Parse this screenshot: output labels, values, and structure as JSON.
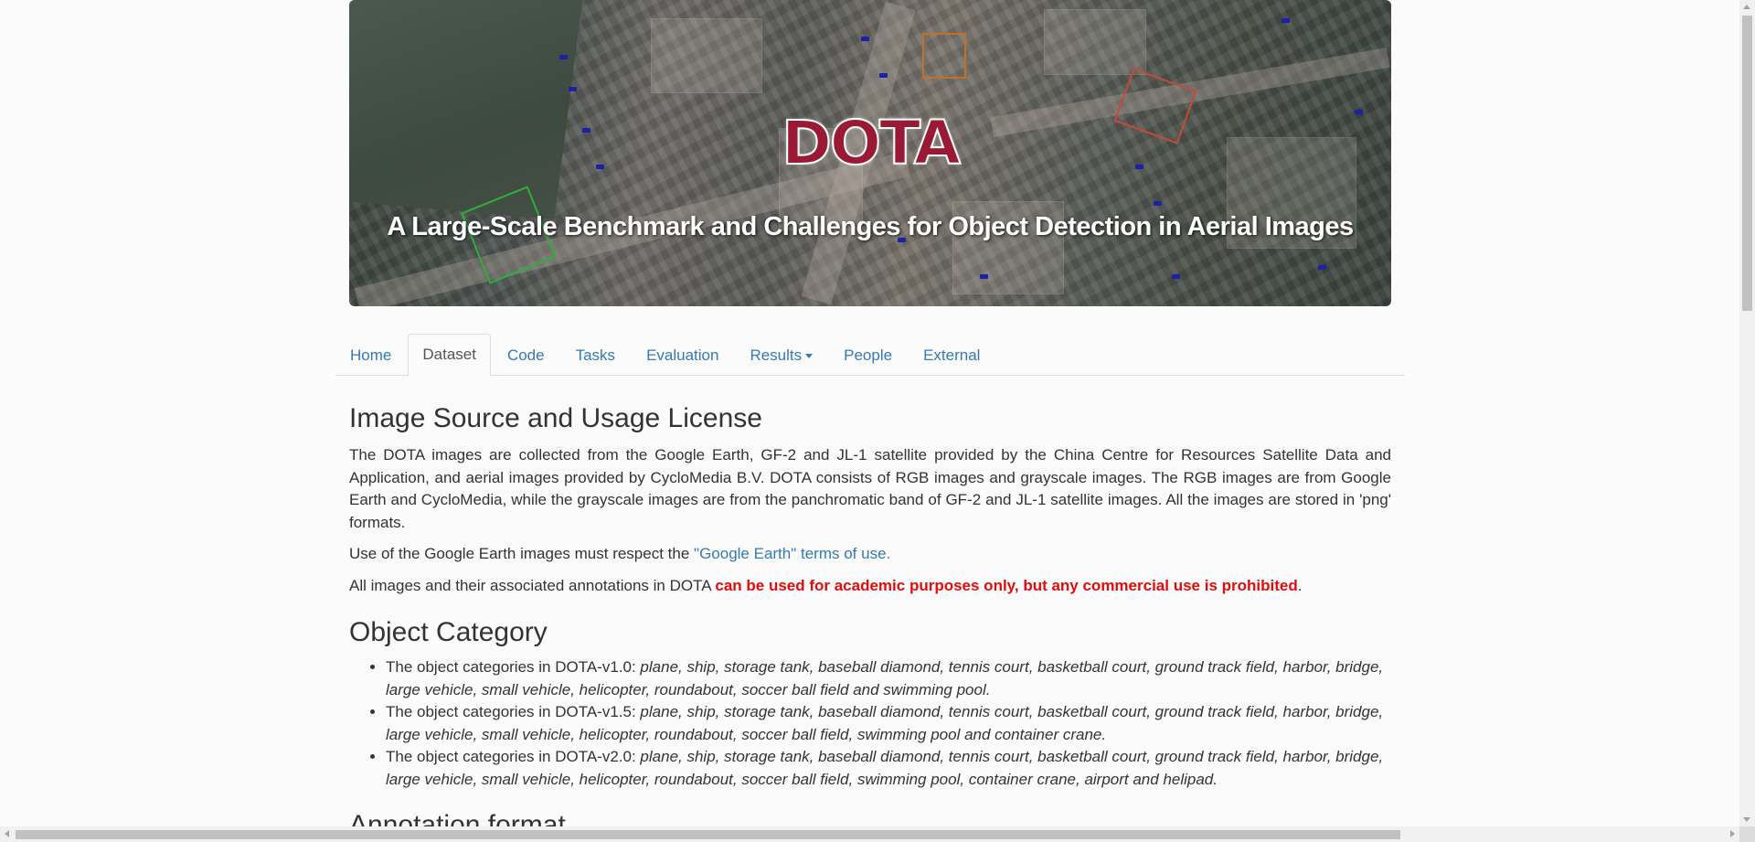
{
  "banner": {
    "title": "DOTA",
    "subtitle": "A Large-Scale Benchmark and Challenges for Object Detection in Aerial Images"
  },
  "nav": {
    "items": [
      {
        "label": "Home",
        "active": false
      },
      {
        "label": "Dataset",
        "active": true
      },
      {
        "label": "Code",
        "active": false
      },
      {
        "label": "Tasks",
        "active": false
      },
      {
        "label": "Evaluation",
        "active": false
      },
      {
        "label": "Results",
        "active": false,
        "dropdown": true
      },
      {
        "label": "People",
        "active": false
      },
      {
        "label": "External",
        "active": false
      }
    ]
  },
  "license": {
    "heading": "Image Source and Usage License",
    "para1": "The DOTA images are collected from the Google Earth, GF-2 and JL-1 satellite provided by the China Centre for Resources Satellite Data and Application, and aerial images provided by CycloMedia B.V. DOTA consists of RGB images and grayscale images. The RGB images are from Google Earth and CycloMedia, while the grayscale images are from the panchromatic band of GF-2 and JL-1 satellite images. All the images are stored in 'png' formats.",
    "para2_prefix": "Use of the Google Earth images must respect the ",
    "para2_link": "\"Google Earth\" terms of use.",
    "para3_prefix": "All images and their associated annotations in DOTA ",
    "para3_warning": "can be used for academic purposes only, but any commercial use is prohibited",
    "para3_suffix": "."
  },
  "categories": {
    "heading": "Object Category",
    "items": [
      {
        "prefix": "The object categories in DOTA-v1.0: ",
        "list": "plane, ship, storage tank, baseball diamond, tennis court, basketball court, ground track field, harbor, bridge, large vehicle, small vehicle, helicopter, roundabout, soccer ball field and swimming pool."
      },
      {
        "prefix": "The object categories in DOTA-v1.5: ",
        "list": "plane, ship, storage tank, baseball diamond, tennis court, basketball court, ground track field, harbor, bridge, large vehicle, small vehicle, helicopter, roundabout, soccer ball field, swimming pool and container crane."
      },
      {
        "prefix": "The object categories in DOTA-v2.0: ",
        "list": "plane, ship, storage tank, baseball diamond, tennis court, basketball court, ground track field, harbor, bridge, large vehicle, small vehicle, helicopter, roundabout, soccer ball field, swimming pool, container crane, airport and helipad."
      }
    ]
  },
  "annotation": {
    "heading": "Annotation format"
  },
  "colors": {
    "link": "#337ab7",
    "warning": "#e30b0b",
    "title": "#9a1a35"
  }
}
